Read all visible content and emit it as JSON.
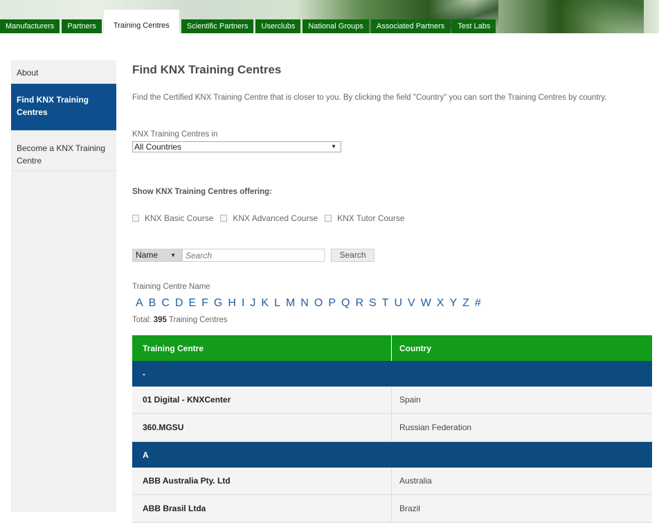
{
  "top_tabs": [
    {
      "label": "Manufacturers"
    },
    {
      "label": "Partners"
    },
    {
      "label": "Training Centres"
    },
    {
      "label": "Scientific Partners"
    },
    {
      "label": "Userclubs"
    },
    {
      "label": "National Groups"
    },
    {
      "label": "Associated Partners"
    },
    {
      "label": "Test Labs"
    }
  ],
  "sidebar": {
    "items": [
      {
        "label": "About"
      },
      {
        "label": "Find KNX Training Centres"
      },
      {
        "label": "Become a KNX Training Centre"
      }
    ]
  },
  "main": {
    "title": "Find KNX Training Centres",
    "intro": "Find the Certified KNX Training Centre that is closer to you. By clicking the field \"Country\" you can sort the Training Centres by country.",
    "filter_label": "KNX Training Centres in",
    "country_select_value": "All Countries",
    "offering_title": "Show KNX Training Centres offering:",
    "courses": [
      {
        "label": "KNX Basic Course"
      },
      {
        "label": "KNX Advanced Course"
      },
      {
        "label": "KNX Tutor Course"
      }
    ],
    "search": {
      "field_select_value": "Name",
      "placeholder": "Search",
      "button_label": "Search"
    },
    "name_label": "Training Centre Name",
    "letters": [
      "A",
      "B",
      "C",
      "D",
      "E",
      "F",
      "G",
      "H",
      "I",
      "J",
      "K",
      "L",
      "M",
      "N",
      "O",
      "P",
      "Q",
      "R",
      "S",
      "T",
      "U",
      "V",
      "W",
      "X",
      "Y",
      "Z",
      "#"
    ],
    "total_prefix": "Total:",
    "total_count": "395",
    "total_suffix": "Training Centres"
  },
  "table": {
    "headers": [
      "Training Centre",
      "Country"
    ],
    "groups": [
      {
        "label": "-",
        "rows": [
          {
            "name": "01 Digital - KNXCenter",
            "country": "Spain"
          },
          {
            "name": "360.MGSU",
            "country": "Russian Federation"
          }
        ]
      },
      {
        "label": "A",
        "rows": [
          {
            "name": "ABB Australia Pty. Ltd",
            "country": "Australia"
          },
          {
            "name": "ABB Brasil Ltda",
            "country": "Brazil"
          }
        ]
      }
    ]
  },
  "colors": {
    "tab_green": "#0b6b0e",
    "header_green": "#129c1a",
    "group_blue": "#0d4a80",
    "sidebar_active": "#0d4f8c",
    "link_blue": "#1e5fa0"
  }
}
